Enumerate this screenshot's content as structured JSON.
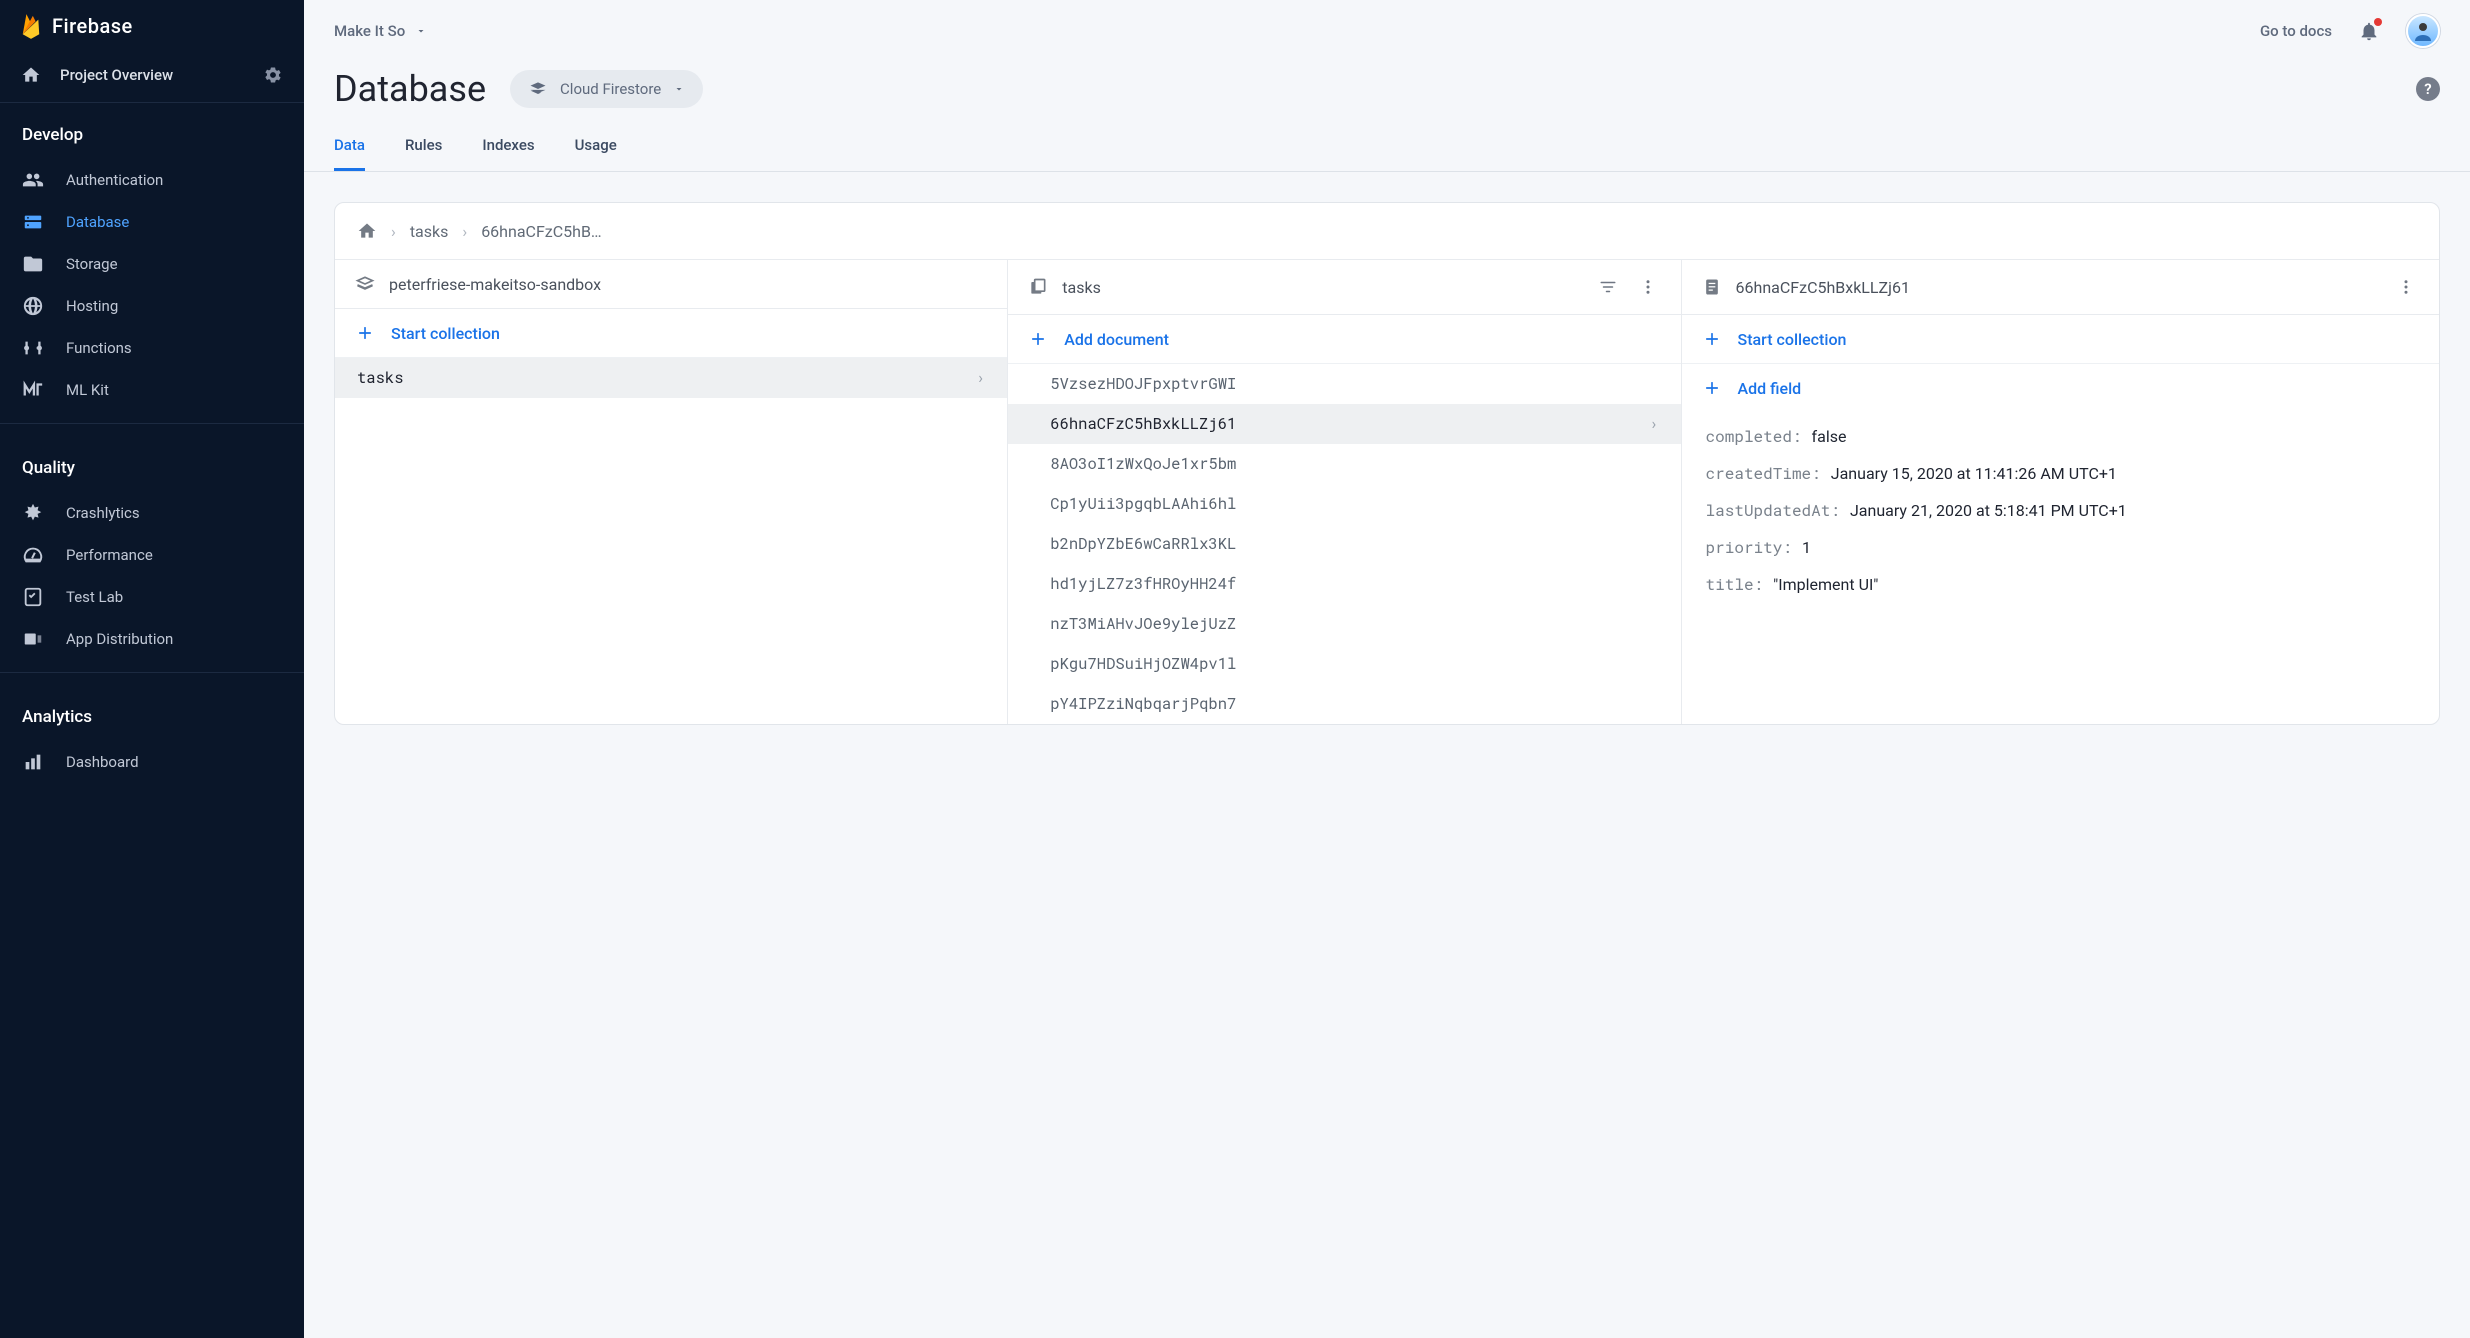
{
  "brand": "Firebase",
  "sidebar": {
    "overview": "Project Overview",
    "sections": {
      "develop": {
        "title": "Develop",
        "items": [
          "Authentication",
          "Database",
          "Storage",
          "Hosting",
          "Functions",
          "ML Kit"
        ],
        "active_index": 1
      },
      "quality": {
        "title": "Quality",
        "items": [
          "Crashlytics",
          "Performance",
          "Test Lab",
          "App Distribution"
        ]
      },
      "analytics": {
        "title": "Analytics",
        "items": [
          "Dashboard"
        ]
      }
    }
  },
  "topbar": {
    "project_name": "Make It So",
    "docs_link": "Go to docs"
  },
  "page": {
    "title": "Database",
    "service_pill": "Cloud Firestore",
    "tabs": [
      "Data",
      "Rules",
      "Indexes",
      "Usage"
    ],
    "active_tab": 0
  },
  "breadcrumb": {
    "items": [
      "tasks",
      "66hnaCFzC5hB…"
    ]
  },
  "columns": {
    "root": {
      "header": "peterfriese-makeitso-sandbox",
      "action": "Start collection",
      "items": [
        "tasks"
      ],
      "selected_index": 0
    },
    "collection": {
      "header": "tasks",
      "action": "Add document",
      "items": [
        "5VzsezHDOJFpxptvrGWI",
        "66hnaCFzC5hBxkLLZj61",
        "8AO3oI1zWxQoJe1xr5bm",
        "Cp1yUii3pgqbLAAhi6hl",
        "b2nDpYZbE6wCaRRlx3KL",
        "hd1yjLZ7z3fHROyHH24f",
        "nzT3MiAHvJOe9ylejUzZ",
        "pKgu7HDSuiHjOZW4pv1l",
        "pY4IPZziNqbqarjPqbn7"
      ],
      "selected_index": 1
    },
    "document": {
      "header": "66hnaCFzC5hBxkLLZj61",
      "action_collection": "Start collection",
      "action_field": "Add field",
      "fields": [
        {
          "key": "completed",
          "value": "false"
        },
        {
          "key": "createdTime",
          "value": "January 15, 2020 at 11:41:26 AM UTC+1"
        },
        {
          "key": "lastUpdatedAt",
          "value": "January 21, 2020 at 5:18:41 PM UTC+1"
        },
        {
          "key": "priority",
          "value": "1"
        },
        {
          "key": "title",
          "value": "\"Implement UI\""
        }
      ]
    }
  }
}
